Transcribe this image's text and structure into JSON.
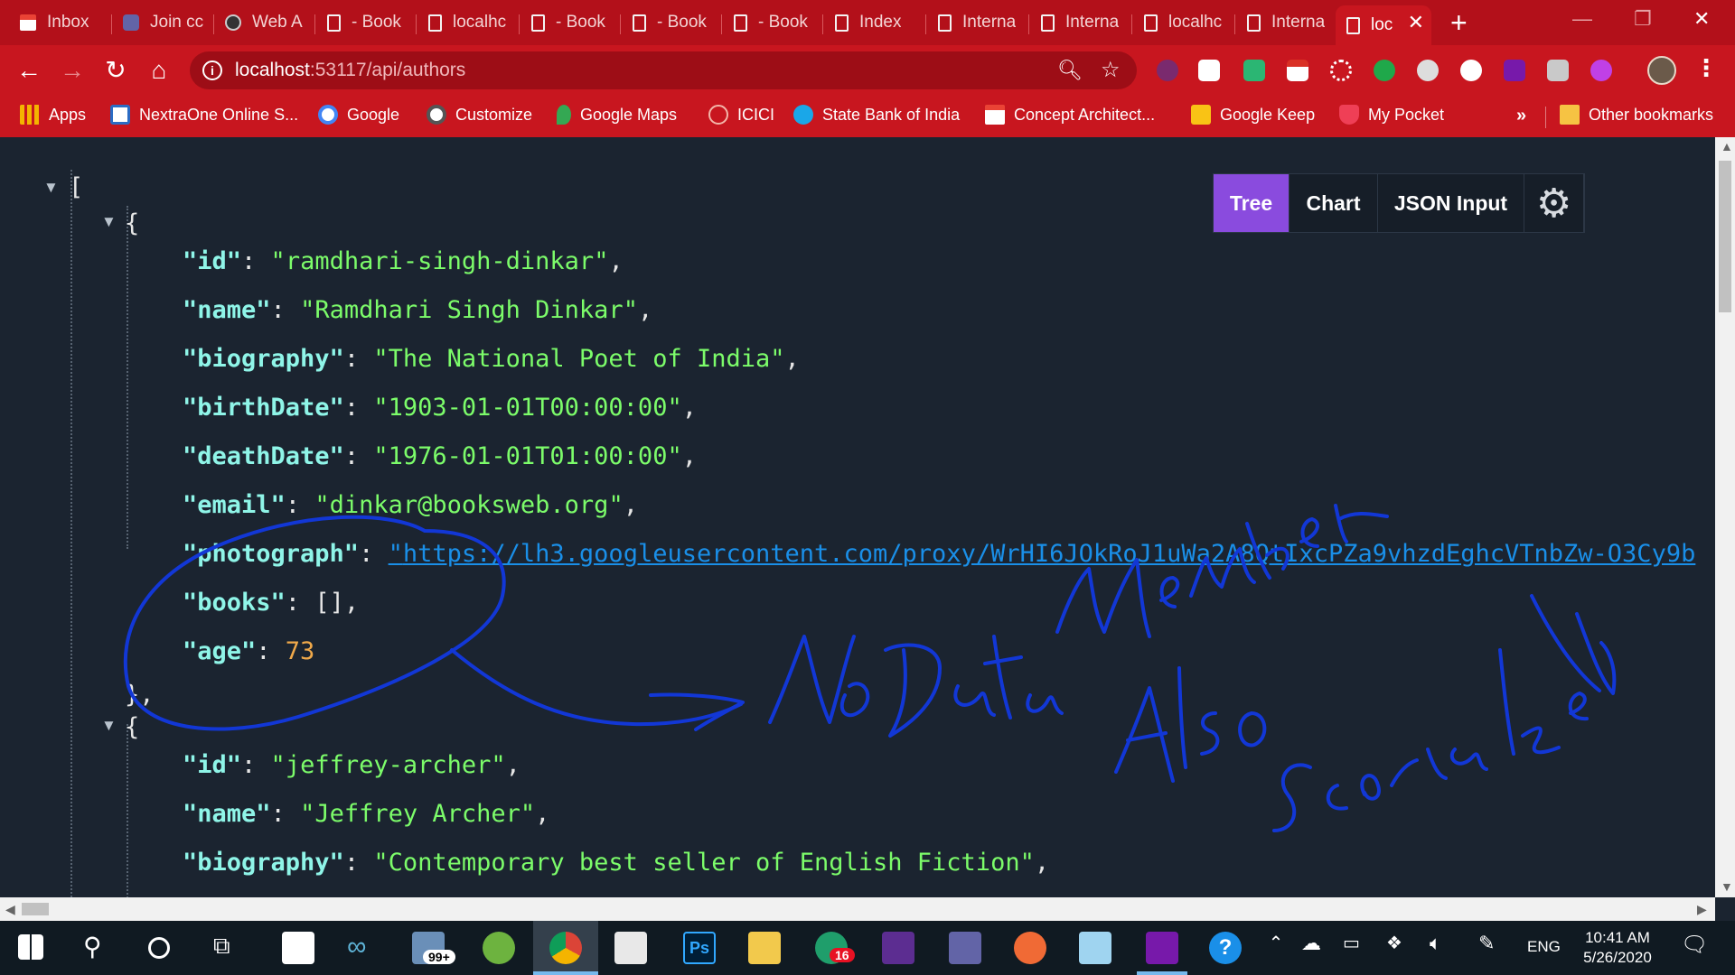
{
  "browser": {
    "tabs": [
      {
        "label": "Inbox",
        "icon": "gmail-icon"
      },
      {
        "label": "Join cc",
        "icon": "teams-icon"
      },
      {
        "label": "Web A",
        "icon": "github-icon"
      },
      {
        "label": "- Book",
        "icon": "page-icon"
      },
      {
        "label": "localhc",
        "icon": "page-icon"
      },
      {
        "label": "- Book",
        "icon": "page-icon"
      },
      {
        "label": "- Book",
        "icon": "page-icon"
      },
      {
        "label": "- Book",
        "icon": "page-icon"
      },
      {
        "label": "Index",
        "icon": "page-icon"
      },
      {
        "label": "Interna",
        "icon": "page-icon"
      },
      {
        "label": "Interna",
        "icon": "page-icon"
      },
      {
        "label": "localhc",
        "icon": "page-icon"
      },
      {
        "label": "Interna",
        "icon": "page-icon"
      },
      {
        "label": "loc",
        "icon": "page-icon",
        "active": true
      }
    ],
    "url_host": "localhost",
    "url_rest": ":53117/api/authors",
    "bookmarks": [
      {
        "label": "Apps",
        "icon": "apps-grid-icon"
      },
      {
        "label": "NextraOne Online S...",
        "icon": "nextraone-icon"
      },
      {
        "label": "Google",
        "icon": "google-icon"
      },
      {
        "label": "Customize",
        "icon": "customize-icon"
      },
      {
        "label": "Google Maps",
        "icon": "maps-pin-icon"
      },
      {
        "label": "ICICI",
        "icon": "icici-icon"
      },
      {
        "label": "State Bank of India",
        "icon": "sbi-icon"
      },
      {
        "label": "Concept Architect...",
        "icon": "gmail-icon"
      },
      {
        "label": "Google Keep",
        "icon": "keep-icon"
      },
      {
        "label": "My Pocket",
        "icon": "pocket-icon"
      }
    ],
    "bookmarks_more": "»",
    "other_bookmarks": "Other bookmarks",
    "accent": "#c8161f"
  },
  "viewer": {
    "tabs": [
      "Tree",
      "Chart",
      "JSON Input"
    ],
    "active_tab": "Tree",
    "json": {
      "open_bracket": "[",
      "open_brace": "{",
      "close_brace": "},",
      "record1": {
        "id": "ramdhari-singh-dinkar",
        "name": "Ramdhari Singh Dinkar",
        "biography": "The National Poet of India",
        "birthDate": "1903-01-01T00:00:00",
        "deathDate": "1976-01-01T01:00:00",
        "email": "dinkar@booksweb.org",
        "photograph": "https://lh3.googleusercontent.com/proxy/WrHI6JOkRoJ1uWa2A8QtIxcPZa9vhzdEghcVTnbZw-O3Cy9b",
        "books": "[]",
        "age": "73"
      },
      "record2": {
        "id": "jeffrey-archer",
        "name": "Jeffrey Archer",
        "biography": "Contemporary best seller of English Fiction"
      }
    }
  },
  "annotation": {
    "text_lines": [
      "No DataMember",
      "Also",
      "Serialized"
    ],
    "color": "#1237d6"
  },
  "taskbar": {
    "mail_badge": "99+",
    "whatsapp_badge": "16",
    "language": "ENG",
    "time": "10:41 AM",
    "date": "5/26/2020"
  }
}
